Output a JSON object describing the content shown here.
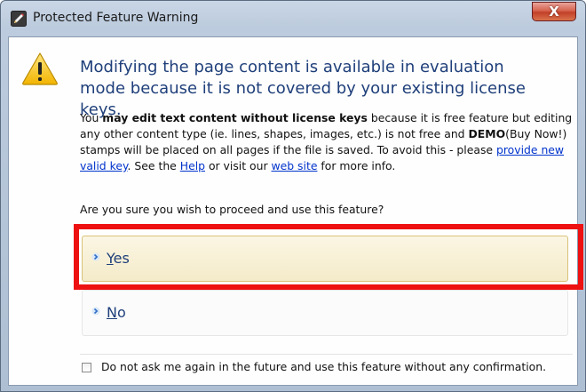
{
  "window": {
    "title": "Protected Feature Warning",
    "close_label": "X"
  },
  "message": {
    "headline": "Modifying the page content is available in evaluation mode because it is not covered by your existing license keys.",
    "body": {
      "p1": "You ",
      "b1": "may edit text content without license keys",
      "p2": " because it is free feature but editing any other content type (ie. lines, shapes, images, etc.) is not free and ",
      "b2": "DEMO",
      "p3": "(Buy Now!) stamps will be placed on all pages if the file is saved. To avoid this - please ",
      "link_key": "provide new valid key",
      "p4": ". See the ",
      "link_help": "Help",
      "p5": " or visit our ",
      "link_web": "web site",
      "p6": " for more info."
    },
    "question": "Are you sure you wish to proceed and use this feature?"
  },
  "commands": {
    "yes": {
      "accel": "Y",
      "rest": "es"
    },
    "no": {
      "accel": "N",
      "rest": "o"
    }
  },
  "footer": {
    "checkbox_label": "Do not ask me again in the future and use this feature without any confirmation.",
    "checked": false
  },
  "colors": {
    "highlight": "#ee1111",
    "link": "#0033cc",
    "headline": "#1f3f7a"
  }
}
